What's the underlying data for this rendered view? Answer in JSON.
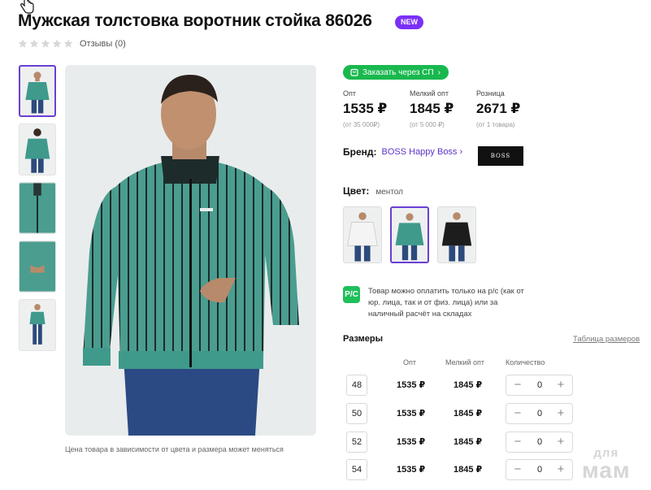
{
  "product": {
    "title": "Мужская толстовка воротник стойка 86026",
    "badge": "NEW",
    "reviews": "Отзывы (0)",
    "rating_stars": 0,
    "photo_note": "Цена товара в зависимости от цвета и размера может меняться"
  },
  "actions": {
    "order_sp": "Заказать через СП"
  },
  "prices": [
    {
      "label": "Опт",
      "value": "1535 ₽",
      "sub": "(от 35 000₽)"
    },
    {
      "label": "Мелкий опт",
      "value": "1845 ₽",
      "sub": "(от 5 000 ₽)"
    },
    {
      "label": "Розница",
      "value": "2671 ₽",
      "sub": "(от 1 товара)"
    }
  ],
  "brand": {
    "label": "Бренд:",
    "name": "BOSS Happy Boss",
    "logo_text": "BOSS"
  },
  "color": {
    "label": "Цвет:",
    "value": "ментол"
  },
  "payment": {
    "icon_text": "P/C",
    "text": "Товар можно оплатить только на р/с (как от юр. лица, так и от физ. лица) или за наличный расчёт на складах"
  },
  "sizes": {
    "title": "Размеры",
    "table_link": "Таблица размеров",
    "headers": {
      "opt": "Опт",
      "melk": "Мелкий опт",
      "qty": "Количество"
    },
    "rows": [
      {
        "size": "48",
        "opt": "1535 ₽",
        "melk": "1845 ₽",
        "qty": "0"
      },
      {
        "size": "50",
        "opt": "1535 ₽",
        "melk": "1845 ₽",
        "qty": "0"
      },
      {
        "size": "52",
        "opt": "1535 ₽",
        "melk": "1845 ₽",
        "qty": "0"
      },
      {
        "size": "54",
        "opt": "1535 ₽",
        "melk": "1845 ₽",
        "qty": "0"
      }
    ]
  },
  "watermark": {
    "line1": "для",
    "line2": "мам"
  },
  "colors": {
    "accent_purple": "#7b2ff7",
    "green": "#19b84e",
    "jacket_mint": "#3f9a8c"
  }
}
